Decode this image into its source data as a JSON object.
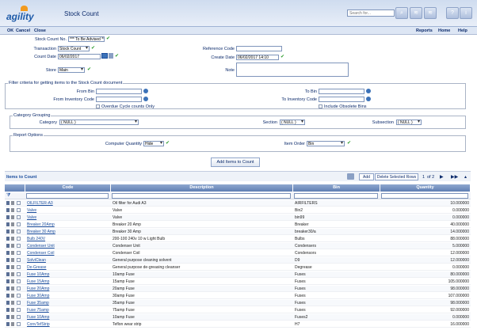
{
  "app": {
    "title": "Stock Count",
    "logo_text": "agility"
  },
  "search": {
    "placeholder": "Search for..."
  },
  "toolbar": {
    "ok": "OK",
    "cancel": "Cancel",
    "close": "Close",
    "reports": "Reports",
    "home": "Home",
    "help": "Help"
  },
  "form": {
    "stock_count_no_label": "Stock Count No.",
    "stock_count_no": "*** To Be Advised ***",
    "transaction_label": "Transaction",
    "transaction": "Stock Count",
    "count_date_label": "Count Date",
    "count_date": "06/02/2017",
    "store_label": "Store",
    "store": "Main",
    "reference_code_label": "Reference Code",
    "reference_code": "",
    "create_date_label": "Create Date",
    "create_date": "06/02/2017 14:10",
    "note_label": "Note",
    "note": ""
  },
  "filter": {
    "legend": "Filter criteria for getting items to the Stock Count document",
    "from_bin_label": "From Bin",
    "to_bin_label": "To Bin",
    "from_inv_label": "From Inventory Code",
    "to_inv_label": "To Inventory Code",
    "overdue_label": "Overdue Cycle counts Only",
    "obsolete_label": "Include Obsolete Bins"
  },
  "category": {
    "legend": "Category Grouping",
    "category_label": "Category",
    "category": "( NULL )",
    "section_label": "Section",
    "section": "( NULL )",
    "subsection_label": "Subsection",
    "subsection": "( NULL )"
  },
  "report": {
    "legend": "Report Options",
    "computer_qty_label": "Computer Quantity",
    "computer_qty": "Hide",
    "item_order_label": "Item Order",
    "item_order": "Bin"
  },
  "add_items_label": "Add Items to Count",
  "items": {
    "title": "Items to Count",
    "add_label": "Add",
    "delete_label": "Delete Selected Rows",
    "page": "1",
    "page_total": "of 2"
  },
  "grid": {
    "columns": [
      "Code",
      "Description",
      "Bin",
      "Quantity"
    ],
    "rows": [
      [
        "OILFILTER-A3",
        "Oil filter for Audi A3",
        "AIRFILTERS",
        "10.000000"
      ],
      [
        "Valve",
        "Valve",
        "Bin2",
        "0.000000"
      ],
      [
        "Valve",
        "Valve",
        "bin99",
        "0.000000"
      ],
      [
        "Breaker 20Amp",
        "Breaker 20 Amp",
        "Breaker",
        "40.000000"
      ],
      [
        "Breaker 30 Amp",
        "Breaker 30 Amp",
        "breaker30/a",
        "14.000000"
      ],
      [
        "Bulb 240V",
        "200-100 240v 10 w Light Bulb",
        "Bulbs",
        "88.000000"
      ],
      [
        "Condenser Unit",
        "Condenser Unit",
        "Condensers",
        "5.000000"
      ],
      [
        "Condenser Coil",
        "Condenser Coil",
        "Condensors",
        "12.000000"
      ],
      [
        "SolviClean",
        "General purpose cleaning solvent",
        "D9",
        "12.000000"
      ],
      [
        "De-Grease",
        "General purpose de-greasing cleanser",
        "Degrease",
        "0.000000"
      ],
      [
        "Fuse 10Amp",
        "10amp Fuse",
        "Fuses",
        "80.000000"
      ],
      [
        "Fuse 15Amp",
        "15amp Fuse",
        "Fuses",
        "105.000000"
      ],
      [
        "Fuse 20Amp",
        "20amp Fuse",
        "Fuses",
        "98.000000"
      ],
      [
        "Fuse 30Amp",
        "30amp Fuse",
        "Fuses",
        "107.000000"
      ],
      [
        "Fuse 35amp",
        "35amp Fuse",
        "Fuses",
        "98.000000"
      ],
      [
        "Fuse 75amp",
        "75amp Fuse",
        "Fuses",
        "92.000000"
      ],
      [
        "Fuse 10Amp",
        "10amp Fuse",
        "Fuses2",
        "0.000000"
      ],
      [
        "ConvTefStrip",
        "Teflon wear strip",
        "H7",
        "16.000000"
      ]
    ]
  }
}
